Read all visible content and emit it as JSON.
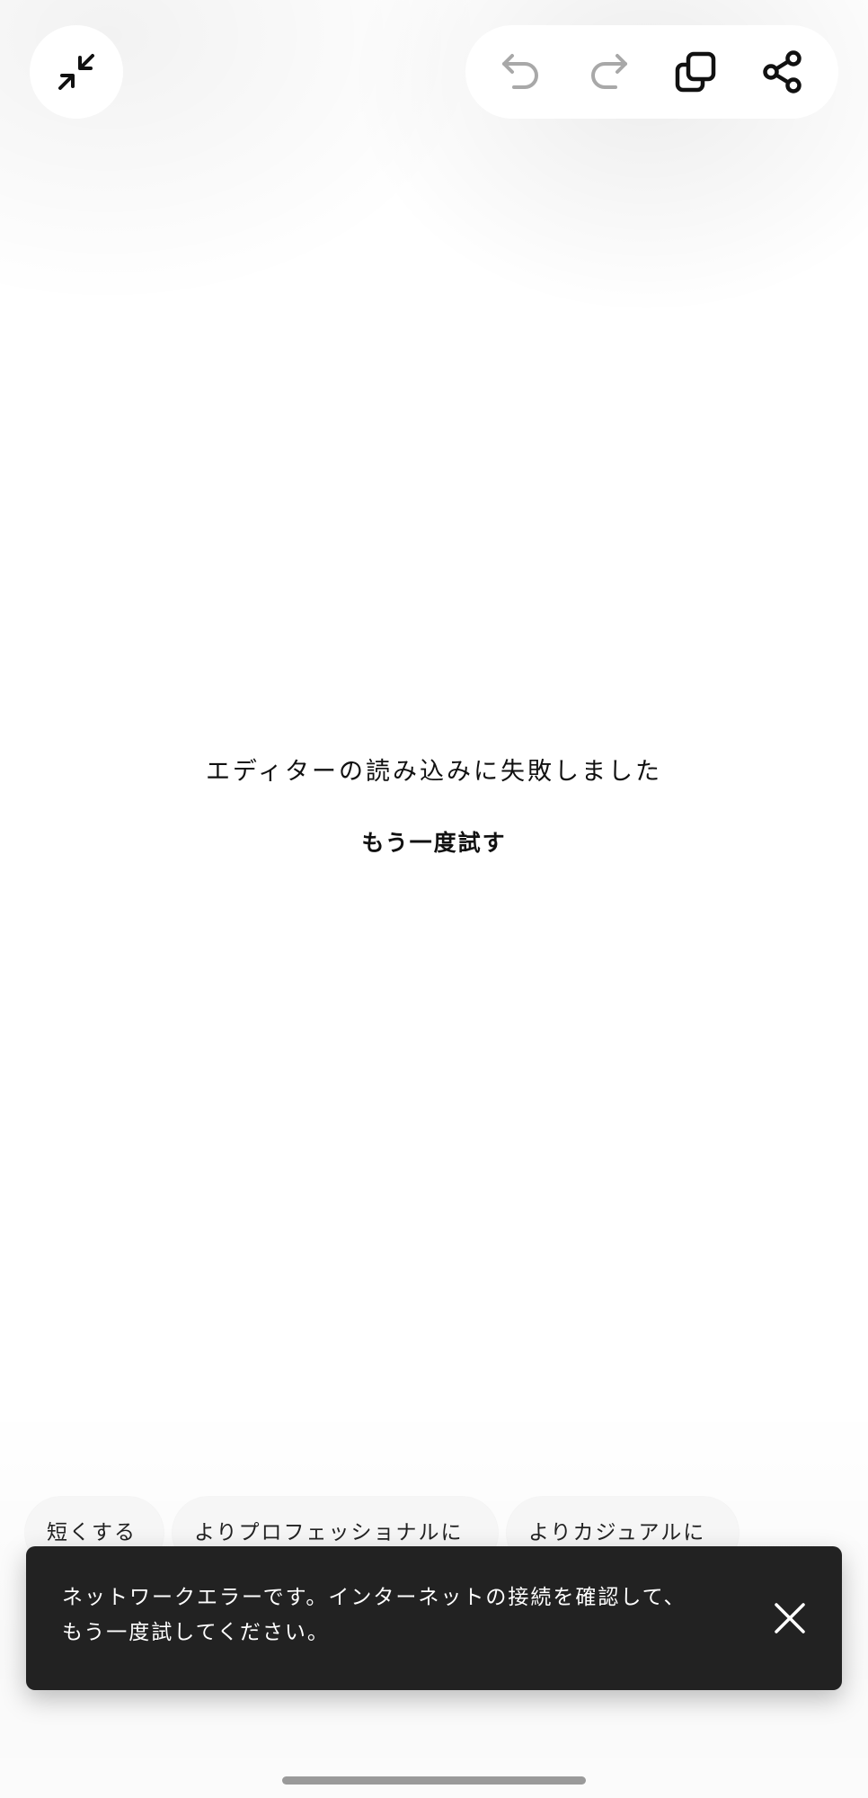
{
  "toolbar": {
    "collapse_icon": "collapse-arrows-icon",
    "undo_icon": "undo-icon",
    "redo_icon": "redo-icon",
    "duplicate_icon": "copy-icon",
    "share_icon": "share-icon",
    "active_icon_color": "#111111",
    "disabled_icon_color": "#a8a8a8"
  },
  "error": {
    "message": "エディターの読み込みに失敗しました",
    "retry_label": "もう一度試す"
  },
  "suggestions": [
    {
      "label": "短くする"
    },
    {
      "label": "よりプロフェッショナルに"
    },
    {
      "label": "よりカジュアルに"
    }
  ],
  "snackbar": {
    "line1": "ネットワークエラーです。インターネットの接続を確認して、",
    "line2": "もう一度試してください。",
    "close_icon": "close-icon",
    "background": "#222222"
  }
}
